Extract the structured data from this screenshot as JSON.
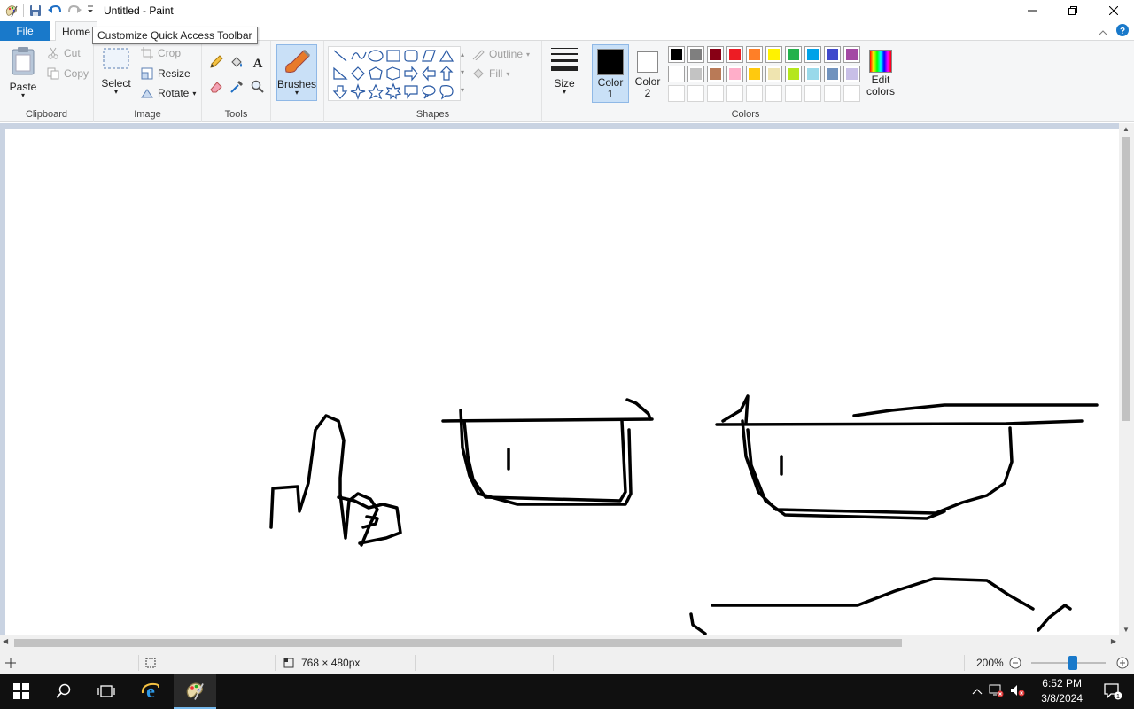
{
  "window": {
    "title": "Untitled - Paint"
  },
  "tooltip": {
    "text": "Customize Quick Access Toolbar"
  },
  "tabs": {
    "file": "File",
    "home": "Home"
  },
  "ribbon": {
    "clipboard": {
      "label": "Clipboard",
      "paste": "Paste",
      "cut": "Cut",
      "copy": "Copy"
    },
    "image": {
      "label": "Image",
      "select": "Select",
      "crop": "Crop",
      "resize": "Resize",
      "rotate": "Rotate"
    },
    "tools": {
      "label": "Tools"
    },
    "brushes": {
      "label": "Brushes"
    },
    "shapes": {
      "label": "Shapes",
      "outline": "Outline",
      "fill": "Fill"
    },
    "size": {
      "label": "Size"
    },
    "colors": {
      "label": "Colors",
      "color1_line1": "Color",
      "color1_line2": "1",
      "color2_line1": "Color",
      "color2_line2": "2",
      "edit_line1": "Edit",
      "edit_line2": "colors",
      "color1_value": "#000000",
      "color2_value": "#ffffff",
      "palette_row1": [
        "#000000",
        "#7f7f7f",
        "#880015",
        "#ed1c24",
        "#ff7f27",
        "#fff200",
        "#22b14c",
        "#00a2e8",
        "#3f48cc",
        "#a349a4"
      ],
      "palette_row2": [
        "#ffffff",
        "#c3c3c3",
        "#b97a57",
        "#ffaec9",
        "#ffc90e",
        "#efe4b0",
        "#b5e61d",
        "#99d9ea",
        "#7092be",
        "#c8bfe7"
      ],
      "palette_row3": [
        "",
        "",
        "",
        "",
        "",
        "",
        "",
        "",
        "",
        ""
      ]
    }
  },
  "status": {
    "image_size": "768 × 480px",
    "zoom": "200%"
  },
  "taskbar": {
    "time": "6:52 PM",
    "date": "3/8/2024"
  }
}
